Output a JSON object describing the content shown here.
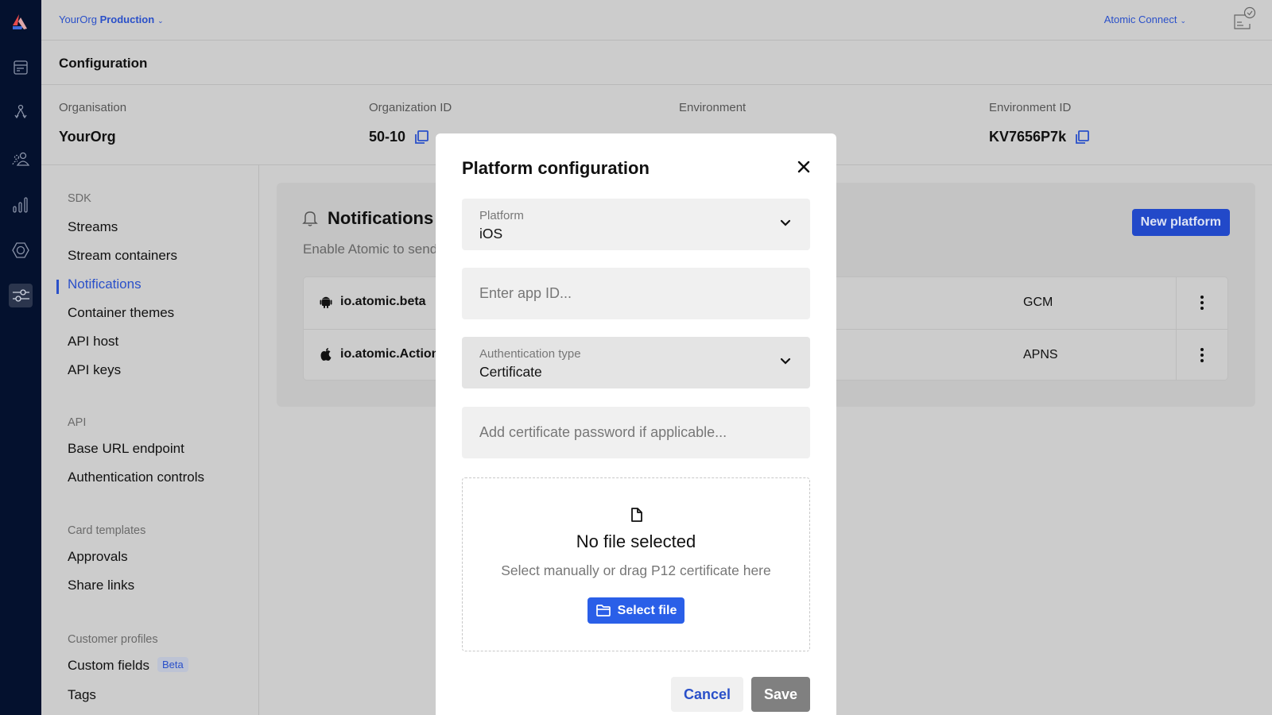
{
  "topbar": {
    "org_name": "YourOrg",
    "environment_name": "Production",
    "app_switcher": "Atomic Connect"
  },
  "page": {
    "title": "Configuration"
  },
  "info": {
    "organisation_label": "Organisation",
    "organisation_value": "YourOrg",
    "organization_id_label": "Organization ID",
    "organization_id_value": "50-10",
    "environment_label": "Environment",
    "environment_id_label": "Environment ID",
    "environment_id_value": "KV7656P7k"
  },
  "rail": {
    "icons": [
      "logo",
      "streams-icon",
      "workflows-icon",
      "customers-icon",
      "analytics-icon",
      "settings-hex-icon",
      "configuration-sliders-icon"
    ],
    "active": "configuration-sliders-icon"
  },
  "sidebar": {
    "groups": [
      {
        "label": "SDK",
        "items": [
          {
            "label": "Streams"
          },
          {
            "label": "Stream containers"
          },
          {
            "label": "Notifications",
            "active": true
          },
          {
            "label": "Container themes"
          },
          {
            "label": "API host"
          },
          {
            "label": "API keys"
          }
        ]
      },
      {
        "label": "API",
        "items": [
          {
            "label": "Base URL endpoint"
          },
          {
            "label": "Authentication controls"
          }
        ]
      },
      {
        "label": "Card templates",
        "items": [
          {
            "label": "Approvals"
          },
          {
            "label": "Share links"
          }
        ]
      },
      {
        "label": "Customer profiles",
        "items": [
          {
            "label": "Custom fields",
            "badge": "Beta"
          },
          {
            "label": "Tags"
          }
        ]
      }
    ]
  },
  "notifications": {
    "title": "Notifications",
    "description": "Enable Atomic to send",
    "new_platform_label": "New platform",
    "platforms": [
      {
        "os": "android",
        "name": "io.atomic.beta",
        "type": "GCM"
      },
      {
        "os": "apple",
        "name": "io.atomic.Action",
        "type": "APNS"
      }
    ]
  },
  "modal": {
    "title": "Platform configuration",
    "platform_label": "Platform",
    "platform_value": "iOS",
    "app_id_placeholder": "Enter app ID...",
    "auth_type_label": "Authentication type",
    "auth_type_value": "Certificate",
    "cert_password_placeholder": "Add certificate password if applicable...",
    "dropzone_title": "No file selected",
    "dropzone_subtitle": "Select manually or drag P12 certificate here",
    "select_file_label": "Select file",
    "cancel_label": "Cancel",
    "save_label": "Save"
  },
  "colors": {
    "accent": "#2a50c9",
    "primary_button": "#2a5fe8",
    "rail_bg": "#04112e",
    "save_disabled": "#808080"
  }
}
